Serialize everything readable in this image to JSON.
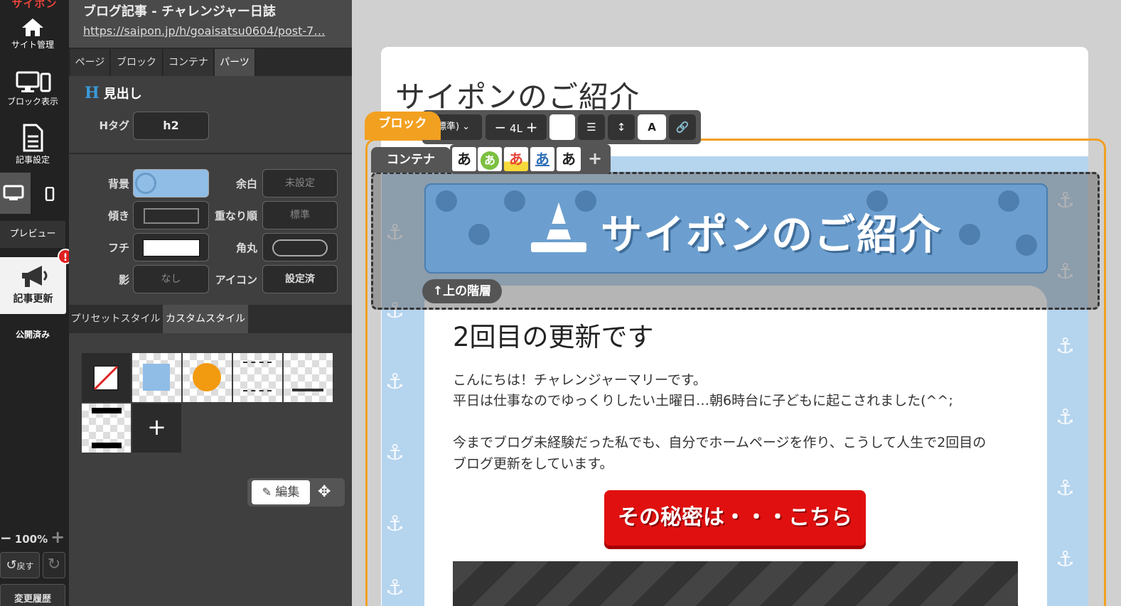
{
  "rail": {
    "logo": "サイポン",
    "site_manage": "サイト管理",
    "block_view": "ブロック表示",
    "article_settings": "記事設定",
    "preview": "プレビュー",
    "badge": "!",
    "update": "記事更新",
    "published": "公開済み",
    "zoom": "100%",
    "undo": "戻す",
    "history": "変更履歴"
  },
  "panel": {
    "title": "ブログ記事 - チャレンジャー日誌",
    "url": "https://saipon.jp/h/goaisatsu0604/post-7…",
    "tabs": [
      "ページ",
      "ブロック",
      "コンテナ",
      "パーツ"
    ],
    "section_title": "見出し",
    "section_icon": "H",
    "htag_label": "Hタグ",
    "htag_value": "h2",
    "fields": {
      "bg": "背景",
      "margin": "余白",
      "margin_value": "未設定",
      "tilt": "傾き",
      "zorder": "重なり順",
      "zorder_value": "標準",
      "border": "フチ",
      "radius": "角丸",
      "shadow": "影",
      "shadow_value": "なし",
      "icon": "アイコン",
      "icon_value": "設定済"
    },
    "style_tabs": [
      "プリセットスタイル",
      "カスタムスタイル"
    ],
    "edit_label": "編集",
    "colors": {
      "bg_swatch": "#8fbde6",
      "orange": "#f29a10"
    }
  },
  "toolbar": {
    "block_tag": "ブロック",
    "container_tag": "コンテナ",
    "size_select": "標準",
    "font_size": "4L",
    "bold_label": "A",
    "font_samples": [
      "あ",
      "あ",
      "あ",
      "あ",
      "あ"
    ]
  },
  "canvas": {
    "page_title": "サイポンのご紹介",
    "heading": "サイポンのご紹介",
    "up_level": "上の階層",
    "h2": "2回目の更新です",
    "para1": "こんにちは！チャレンジャーマリーです。",
    "para2": "平日は仕事なのでゆっくりしたい土曜日…朝6時台に子どもに起こされました(^^;",
    "para3": "今までブログ未経験だった私でも、自分でホームページを作り、こうして人生で2回目の",
    "para4": "ブログ更新をしています。",
    "cta": "その秘密は・・・こちら"
  }
}
